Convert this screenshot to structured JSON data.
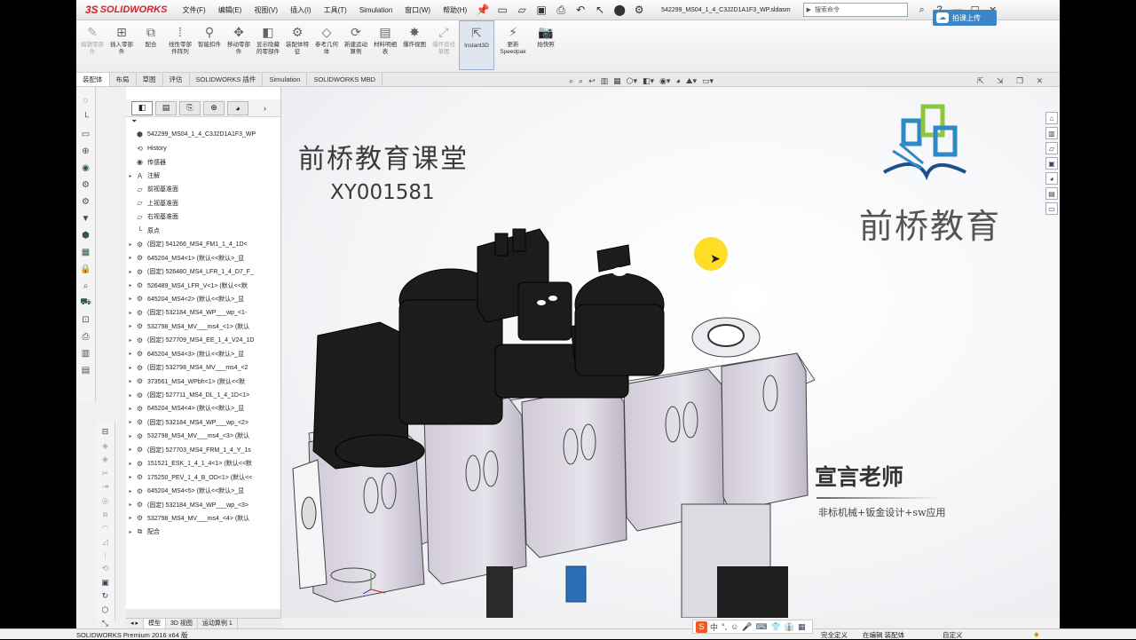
{
  "app": {
    "brand": "SOLIDWORKS",
    "doc_title": "542299_MS04_1_4_C3J2D1A1F3_WP.sldasm",
    "search_placeholder": "搜索命令",
    "upload_label": "拍课上传"
  },
  "menu": [
    "文件(F)",
    "编辑(E)",
    "视图(V)",
    "插入(I)",
    "工具(T)",
    "Simulation",
    "窗口(W)",
    "帮助(H)"
  ],
  "commands": [
    {
      "label": "编辑零部件",
      "icon": "edit-component-icon",
      "disabled": true
    },
    {
      "label": "插入零部件",
      "icon": "insert-component-icon",
      "disabled": false
    },
    {
      "label": "配合",
      "icon": "mate-icon",
      "disabled": false
    },
    {
      "label": "线性零部件阵列",
      "icon": "linear-pattern-icon",
      "disabled": false
    },
    {
      "label": "智能扣件",
      "icon": "smart-fastener-icon",
      "disabled": false
    },
    {
      "label": "移动零部件",
      "icon": "move-component-icon",
      "disabled": false
    },
    {
      "label": "显示隐藏的零部件",
      "icon": "show-hidden-icon",
      "disabled": false
    },
    {
      "label": "装配体特征",
      "icon": "assembly-feature-icon",
      "disabled": false
    },
    {
      "label": "参考几何体",
      "icon": "reference-geometry-icon",
      "disabled": false
    },
    {
      "label": "新建运动算例",
      "icon": "motion-study-icon",
      "disabled": false
    },
    {
      "label": "材料明细表",
      "icon": "bom-icon",
      "disabled": false
    },
    {
      "label": "爆炸视图",
      "icon": "exploded-view-icon",
      "disabled": false
    },
    {
      "label": "爆炸直线草图",
      "icon": "explode-line-icon",
      "disabled": true
    },
    {
      "label": "Instant3D",
      "icon": "instant3d-icon",
      "disabled": false,
      "active": true
    },
    {
      "label": "更新 Speedpak",
      "icon": "speedpak-icon",
      "disabled": false
    },
    {
      "label": "拍快照",
      "icon": "snapshot-icon",
      "disabled": false
    }
  ],
  "cmd_tabs": [
    "装配体",
    "布局",
    "草图",
    "评估",
    "SOLIDWORKS 插件",
    "Simulation",
    "SOLIDWORKS MBD"
  ],
  "tree": {
    "root": "542299_MS04_1_4_C3J2D1A1F3_WP",
    "items": [
      {
        "label": "History",
        "icon": "history-icon",
        "toggle": false
      },
      {
        "label": "传感器",
        "icon": "sensor-icon",
        "toggle": false
      },
      {
        "label": "注解",
        "icon": "annotation-icon",
        "toggle": true
      },
      {
        "label": "前视基准面",
        "icon": "plane-icon",
        "toggle": false
      },
      {
        "label": "上视基准面",
        "icon": "plane-icon",
        "toggle": false
      },
      {
        "label": "右视基准面",
        "icon": "plane-icon",
        "toggle": false
      },
      {
        "label": "原点",
        "icon": "origin-icon",
        "toggle": false
      },
      {
        "label": "(固定) 541266_MS4_FM1_1_4_1D<",
        "icon": "part-icon",
        "toggle": true
      },
      {
        "label": "645204_MS4<1> (默认<<默认>_显",
        "icon": "part-icon",
        "toggle": true
      },
      {
        "label": "(固定) 526480_MS4_LFR_1_4_D7_F_",
        "icon": "part-icon",
        "toggle": true
      },
      {
        "label": "526489_MS4_LFR_V<1> (默认<<默",
        "icon": "part-icon",
        "toggle": true
      },
      {
        "label": "645204_MS4<2> (默认<<默认>_显",
        "icon": "part-icon",
        "toggle": true
      },
      {
        "label": "(固定) 532184_MS4_WP___wp_<1-",
        "icon": "part-icon",
        "toggle": true
      },
      {
        "label": "532798_MS4_MV___ms4_<1> (默认",
        "icon": "part-icon",
        "toggle": true
      },
      {
        "label": "(固定) 527709_MS4_EE_1_4_V24_1D",
        "icon": "part-icon",
        "toggle": true
      },
      {
        "label": "645204_MS4<3> (默认<<默认>_显",
        "icon": "part-icon",
        "toggle": true
      },
      {
        "label": "(固定) 532798_MS4_MV___ms4_<2",
        "icon": "part-icon",
        "toggle": true
      },
      {
        "label": "373561_MS4_WPbh<1> (默认<<默",
        "icon": "part-icon",
        "toggle": true
      },
      {
        "label": "(固定) 527711_MS4_DL_1_4_1D<1>",
        "icon": "part-icon",
        "toggle": true
      },
      {
        "label": "645204_MS4<4> (默认<<默认>_显",
        "icon": "part-icon",
        "toggle": true
      },
      {
        "label": "(固定) 532184_MS4_WP___wp_<2>",
        "icon": "part-icon",
        "toggle": true
      },
      {
        "label": "532798_MS4_MV___ms4_<3> (默认",
        "icon": "part-icon",
        "toggle": true
      },
      {
        "label": "(固定) 527703_MS4_FRM_1_4_Y_1s",
        "icon": "part-icon",
        "toggle": true
      },
      {
        "label": "151521_ESK_1_4_1_4<1> (默认<<默",
        "icon": "part-icon",
        "toggle": true
      },
      {
        "label": "175250_PEV_1_4_B_OD<1> (默认<<",
        "icon": "part-icon",
        "toggle": true
      },
      {
        "label": "645204_MS4<5> (默认<<默认>_显",
        "icon": "part-icon",
        "toggle": true
      },
      {
        "label": "(固定) 532184_MS4_WP___wp_<3>",
        "icon": "part-icon",
        "toggle": true
      },
      {
        "label": "532798_MS4_MV___ms4_<4> (默认",
        "icon": "part-icon",
        "toggle": true
      },
      {
        "label": "配合",
        "icon": "mates-folder-icon",
        "toggle": true
      }
    ]
  },
  "tree_foot": [
    "模型",
    "3D 视图",
    "运动算例 1"
  ],
  "watermark": {
    "title": "前桥教育课堂",
    "code": "XY001581",
    "brand": "前桥教育",
    "teacher": "宣言老师",
    "subtitle": "非标机械+钣金设计+sw应用"
  },
  "status": {
    "version": "SOLIDWORKS Premium 2016 x64 版",
    "state": "完全定义",
    "editing": "在编辑 装配体",
    "custom": "自定义"
  },
  "ime": [
    "中",
    "°,",
    "☺",
    "🎤",
    "⌨",
    "👕",
    "👔",
    "▦"
  ],
  "colors": {
    "brand_red": "#d2232a",
    "upload_blue": "#3b86c6",
    "cursor_yellow": "#ffd600"
  }
}
